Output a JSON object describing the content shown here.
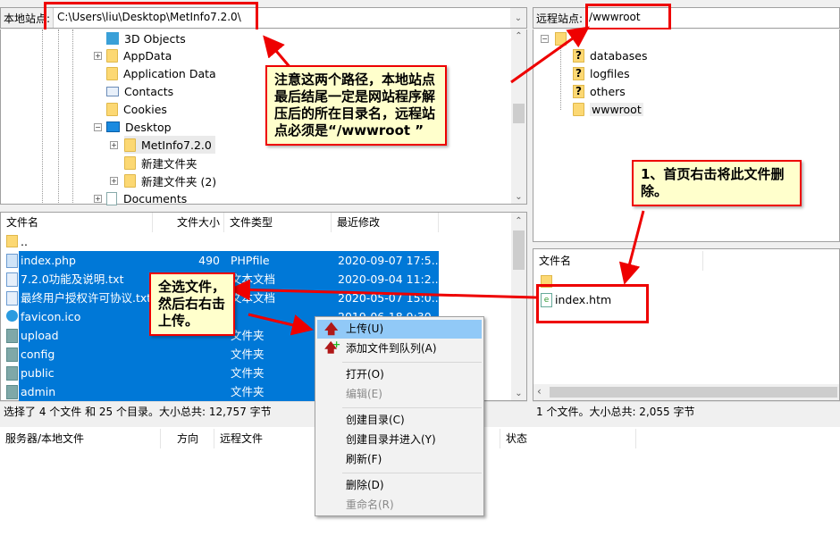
{
  "local": {
    "site_label": "本地站点:",
    "path": "C:\\Users\\liu\\Desktop\\MetInfo7.2.0\\",
    "tree": [
      "3D Objects",
      "AppData",
      "Application Data",
      "Contacts",
      "Cookies",
      "Desktop",
      "MetInfo7.2.0",
      "新建文件夹",
      "新建文件夹 (2)",
      "Documents"
    ],
    "columns": {
      "name": "文件名",
      "size": "文件大小",
      "type": "文件类型",
      "modified": "最近修改"
    },
    "files": [
      {
        "name": "..",
        "size": "",
        "type": "",
        "modified": "",
        "icon": "folder",
        "selected": false
      },
      {
        "name": "index.php",
        "size": "490",
        "type": "PHPfile",
        "modified": "2020-09-07 17:5...",
        "icon": "file",
        "selected": true
      },
      {
        "name": "7.2.0功能及说明.txt",
        "size": "",
        "type": "文本文档",
        "modified": "2020-09-04 11:2...",
        "icon": "text-file",
        "selected": true
      },
      {
        "name": "最终用户授权许可协议.txt",
        "size": "",
        "type": "文本文档",
        "modified": "2020-05-07 15:0...",
        "icon": "text-file",
        "selected": true
      },
      {
        "name": "favicon.ico",
        "size": "",
        "type": "",
        "modified": "2019-06-18 9:30",
        "icon": "metinfo",
        "selected": true
      },
      {
        "name": "upload",
        "size": "",
        "type": "文件夹",
        "modified": "",
        "icon": "folder",
        "selected": true
      },
      {
        "name": "config",
        "size": "",
        "type": "文件夹",
        "modified": "",
        "icon": "folder",
        "selected": true
      },
      {
        "name": "public",
        "size": "",
        "type": "文件夹",
        "modified": "",
        "icon": "folder",
        "selected": true
      },
      {
        "name": "admin",
        "size": "",
        "type": "文件夹",
        "modified": "",
        "icon": "folder",
        "selected": true
      }
    ],
    "status": "选择了 4 个文件 和 25 个目录。大小总共: 12,757 字节"
  },
  "remote": {
    "site_label": "远程站点:",
    "path": "/wwwroot",
    "tree": [
      "databases",
      "logfiles",
      "others",
      "wwwroot"
    ],
    "columns": {
      "name": "文件名"
    },
    "files": [
      {
        "name": ".."
      },
      {
        "name": "index.htm"
      }
    ],
    "status": "1 个文件。大小总共: 2,055 字节"
  },
  "queue": {
    "columns": [
      "服务器/本地文件",
      "方向",
      "远程文件",
      "优先级",
      "状态"
    ]
  },
  "context_menu": [
    {
      "label": "上传(U)",
      "icon": "upload-arrow",
      "highlighted": true
    },
    {
      "label": "添加文件到队列(A)",
      "icon": "add-queue"
    },
    {
      "label": "打开(O)"
    },
    {
      "label": "编辑(E)",
      "disabled": true
    },
    {
      "label": "创建目录(C)"
    },
    {
      "label": "创建目录并进入(Y)"
    },
    {
      "label": "刷新(F)"
    },
    {
      "label": "删除(D)"
    },
    {
      "label": "重命名(R)",
      "disabled": true
    }
  ],
  "annotations": {
    "paths_note": "注意这两个路径，本地站点最后结尾一定是网站程序解压后的所在目录名，远程站点必须是“/wwwroot ”",
    "delete_note": "1、首页右击将此文件删除。",
    "upload_note": "全选文件，然后右右击上传。"
  },
  "colors": {
    "selection": "#0078d7",
    "annotation_border": "#e00000",
    "annotation_fill": "#ffffcc",
    "menu_highlight": "#91c9f7"
  }
}
